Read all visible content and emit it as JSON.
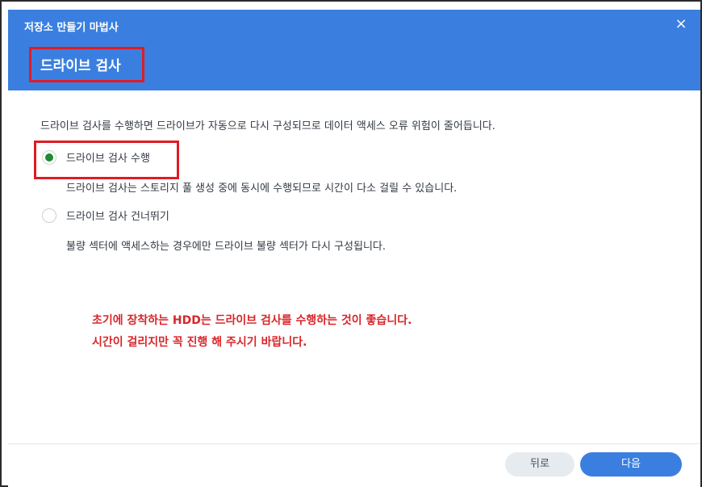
{
  "window": {
    "title": "저장소 만들기 마법사",
    "close_icon": "×"
  },
  "step": {
    "title": "드라이브 검사"
  },
  "content": {
    "description": "드라이브 검사를 수행하면 드라이브가 자동으로 다시 구성되므로 데이터 액세스 오류 위험이 줄어듭니다.",
    "options": [
      {
        "label": "드라이브 검사 수행",
        "help": "드라이브 검사는 스토리지 풀 생성 중에 동시에 수행되므로 시간이 다소 걸릴 수 있습니다.",
        "selected": true
      },
      {
        "label": "드라이브 검사 건너뛰기",
        "help": "불량 섹터에 액세스하는 경우에만 드라이브 불량 섹터가 다시 구성됩니다.",
        "selected": false
      }
    ]
  },
  "annotation": {
    "line1": "초기에 장착하는 HDD는 드라이브 검사를 수행하는 것이 좋습니다.",
    "line2": "시간이 걸리지만 꼭 진행 해 주시기 바랍니다.",
    "color": "#d9262a",
    "highlight_color": "#f5f200"
  },
  "footer": {
    "back_label": "뒤로",
    "next_label": "다음"
  },
  "colors": {
    "accent": "#3a7fe0",
    "radio_selected": "#1f8a2f"
  }
}
